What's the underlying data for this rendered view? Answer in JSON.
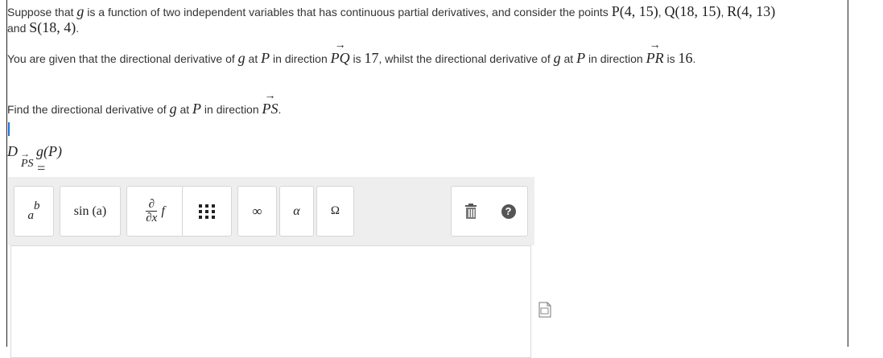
{
  "problem": {
    "intro_text": "Suppose that ",
    "intro_var": "g",
    "intro_rest": " is a function of two independent variables that has continuous partial derivatives, and consider the points ",
    "points": [
      "P(4, 15)",
      "Q(18, 15)",
      "R(4, 13)"
    ],
    "sep": ", ",
    "line2_and": "and ",
    "point_s": "S(18, 4)",
    "line2_end": ".",
    "given_a": "You are given that the directional derivative of ",
    "g": "g",
    "at": " at ",
    "P": "P",
    "in_dir": " in direction ",
    "vec_pq": "PQ",
    "is": " is ",
    "val_pq": "17",
    "whilst": ", whilst the directional derivative of ",
    "vec_pr": "PR",
    "val_pr": "16",
    "period": ".",
    "find_a": "Find the directional derivative of ",
    "vec_ps": "PS"
  },
  "answer_label": {
    "D": "D",
    "arrow": "→",
    "sub": "PS",
    "gP": "g(P) ="
  },
  "toolbar": {
    "superscript_label_base": "a",
    "superscript_label_exp": "b",
    "sin_label": "sin (a)",
    "deriv_top": "∂",
    "deriv_bottom": "∂x",
    "deriv_f": "f",
    "infinity_label": "∞",
    "alpha_label": "α",
    "omega_label": "Ω",
    "help_label": "?"
  }
}
